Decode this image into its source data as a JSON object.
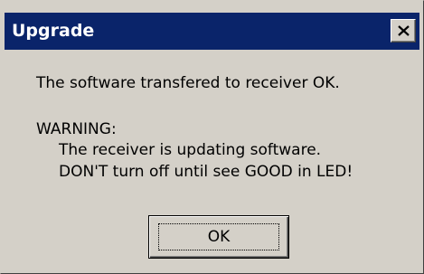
{
  "window": {
    "title": "Upgrade",
    "close_icon": "close-x-icon"
  },
  "message": {
    "line1": "The software transfered to receiver OK.",
    "warning_heading": "WARNING:",
    "warning_line1": "The receiver is updating software.",
    "warning_line2": "DON'T turn off until see GOOD in LED!"
  },
  "buttons": {
    "ok_label": "OK"
  },
  "colors": {
    "titlebar": "#0a246a",
    "dialog_face": "#d4d0c8",
    "title_text": "#ffffff"
  }
}
